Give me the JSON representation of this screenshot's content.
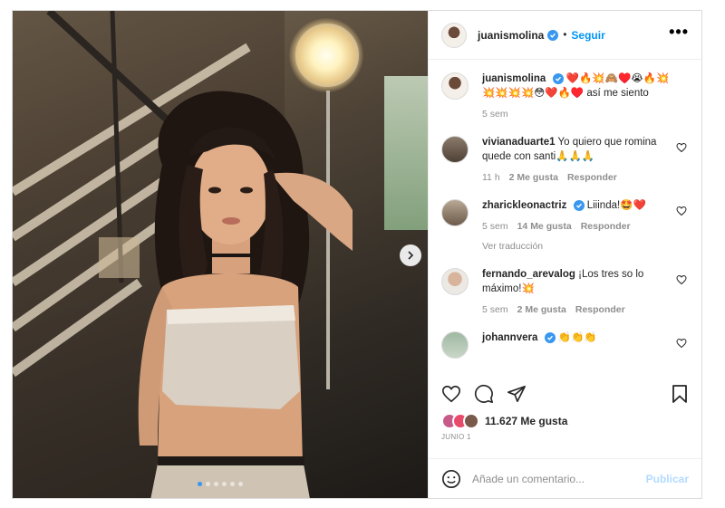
{
  "post": {
    "username": "juanismolina",
    "follow_label": "Seguir",
    "separator": "•",
    "more_label": "•••"
  },
  "caption": {
    "username": "juanismolina",
    "text": "❤️🔥💥🙈♥️😭🔥💥💥💥💥💥😳❤️🔥♥️ así me siento",
    "time": "5 sem"
  },
  "comments": [
    {
      "username": "vivianaduarte1",
      "text": "Yo quiero que romina quede con santi🙏🙏🙏",
      "time": "11 h",
      "likes": "2 Me gusta",
      "reply": "Responder",
      "verified": false
    },
    {
      "username": "zharickleonactriz",
      "text": "Liiinda!🤩❤️",
      "time": "5 sem",
      "likes": "14 Me gusta",
      "reply": "Responder",
      "translate": "Ver traducción",
      "verified": true
    },
    {
      "username": "fernando_arevalog",
      "text": "¡Los tres so lo máximo!💥",
      "time": "5 sem",
      "likes": "2 Me gusta",
      "reply": "Responder",
      "verified": false
    },
    {
      "username": "johannvera",
      "text": "👏👏👏",
      "verified": true
    }
  ],
  "likes": {
    "count_label": "11.627 Me gusta"
  },
  "date": "JUNIO 1",
  "composer": {
    "placeholder": "Añade un comentario...",
    "publish_label": "Publicar"
  },
  "carousel": {
    "total": 6,
    "active_index": 0
  },
  "colors": {
    "accent": "#0095f6",
    "verified": "#3897f0",
    "muted": "#8e8e8e",
    "text": "#262626"
  },
  "icons": [
    "verified-icon",
    "more-icon",
    "next-arrow-icon",
    "heart-icon",
    "comment-icon",
    "share-icon",
    "bookmark-icon",
    "emoji-icon"
  ]
}
